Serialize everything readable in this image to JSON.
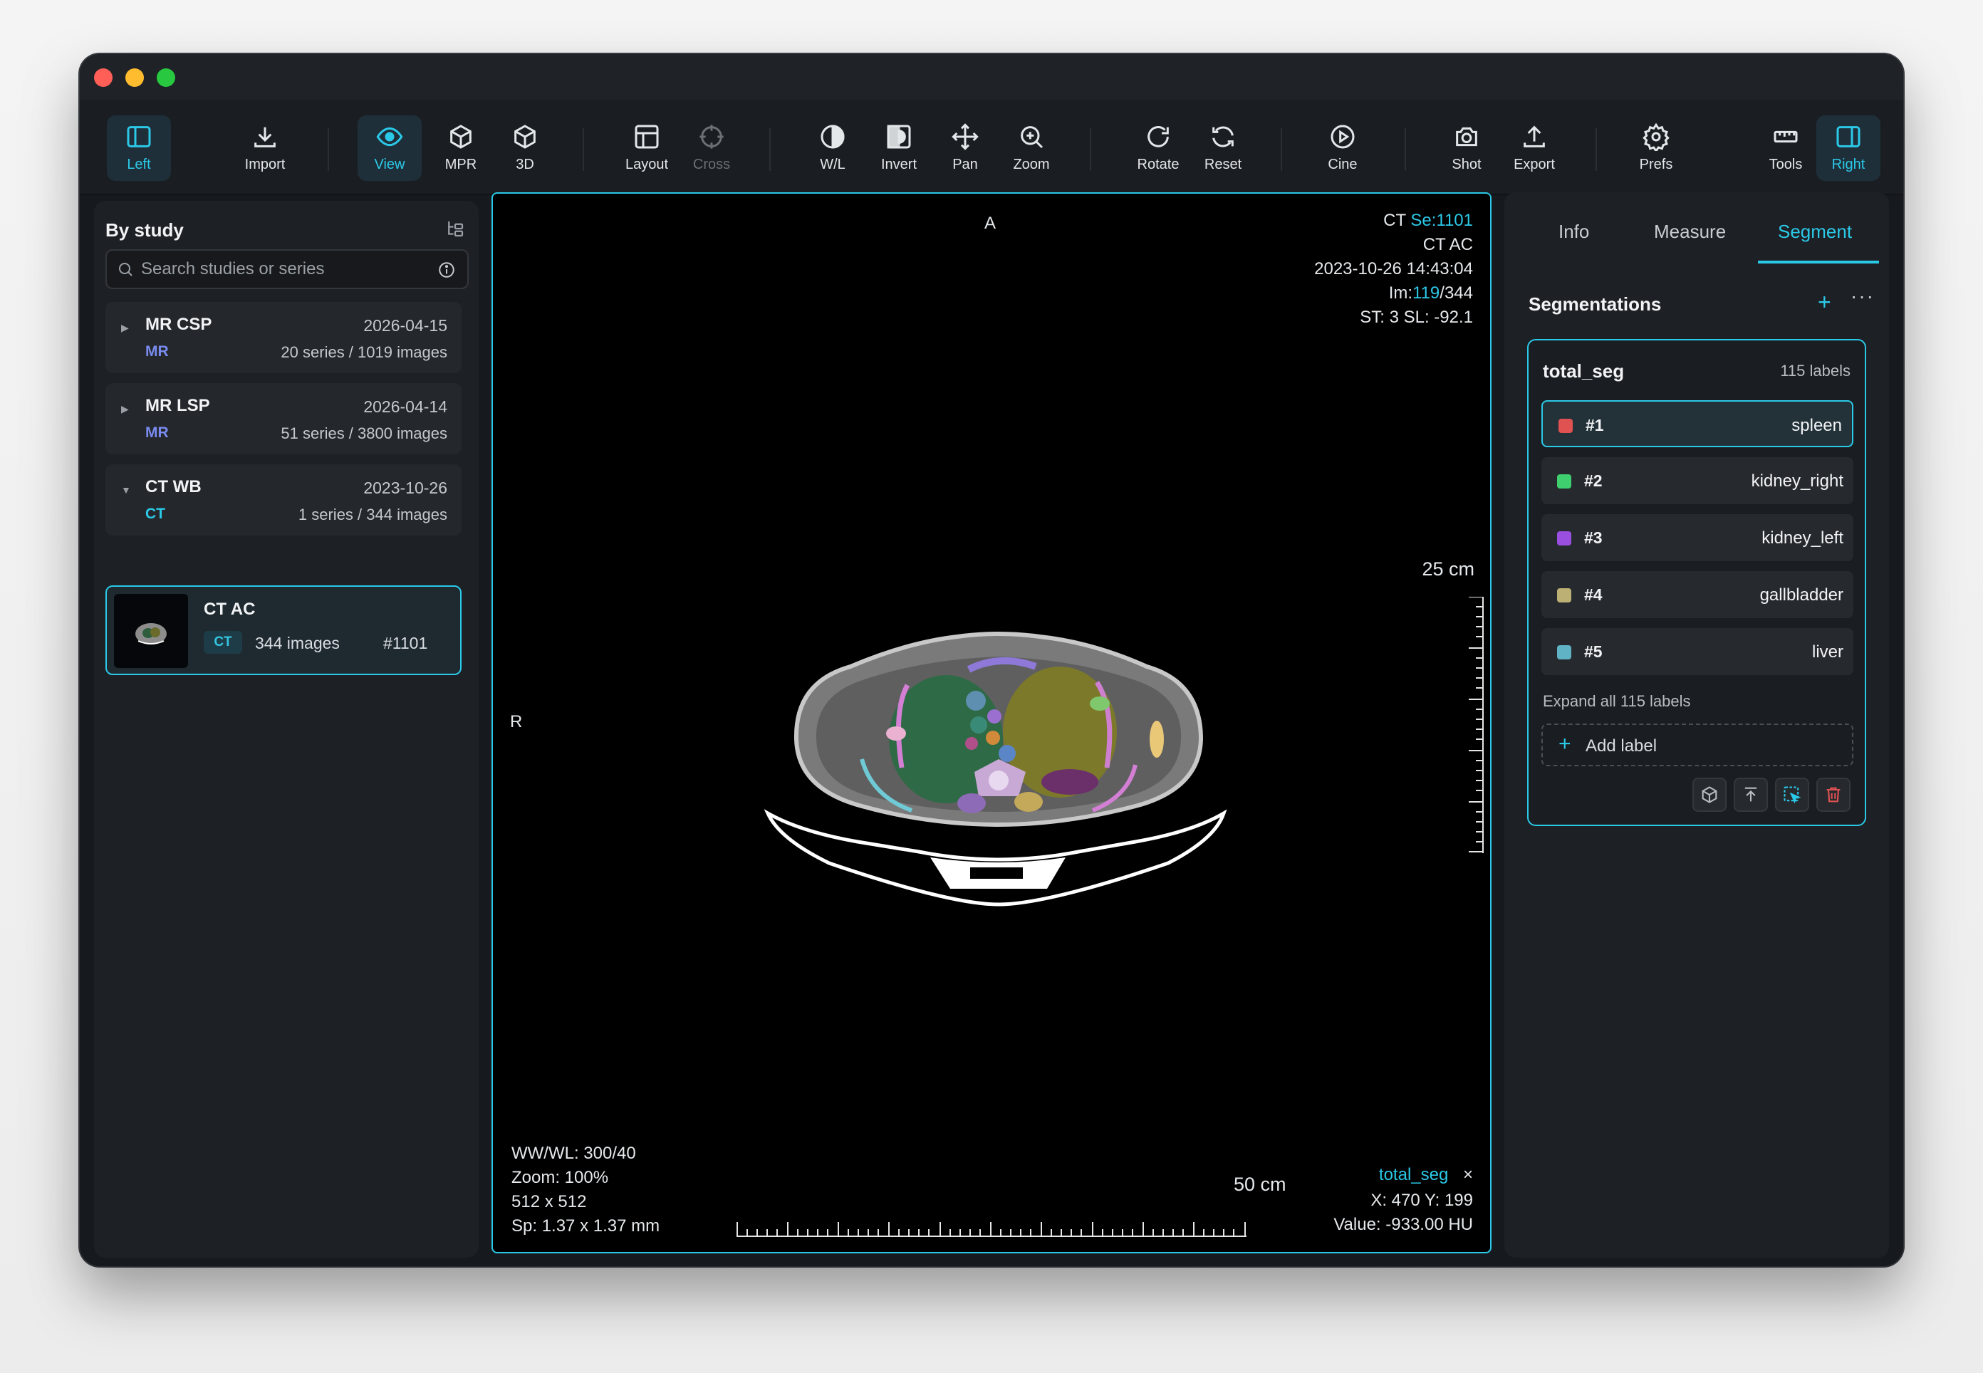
{
  "toolbar": {
    "left": "Left",
    "import": "Import",
    "view": "View",
    "mpr": "MPR",
    "three_d": "3D",
    "layout": "Layout",
    "cross": "Cross",
    "wl": "W/L",
    "invert": "Invert",
    "pan": "Pan",
    "zoom": "Zoom",
    "rotate": "Rotate",
    "reset": "Reset",
    "cine": "Cine",
    "shot": "Shot",
    "export": "Export",
    "prefs": "Prefs",
    "tools": "Tools",
    "right": "Right"
  },
  "left_panel": {
    "title": "By study",
    "search_placeholder": "Search studies or series",
    "studies": [
      {
        "name": "MR CSP",
        "date": "2026-04-15",
        "modality": "MR",
        "count": "20 series / 1019 images",
        "expanded": false
      },
      {
        "name": "MR LSP",
        "date": "2026-04-14",
        "modality": "MR",
        "count": "51 series / 3800 images",
        "expanded": false
      },
      {
        "name": "CT WB",
        "date": "2023-10-26",
        "modality": "CT",
        "count": "1 series / 344 images",
        "expanded": true
      }
    ],
    "series": {
      "name": "CT AC",
      "modality": "CT",
      "images": "344 images",
      "number": "#1101"
    }
  },
  "viewport": {
    "orient_top": "A",
    "orient_left": "R",
    "top_right": {
      "modality": "CT",
      "series_label": "Se:",
      "series_num": "1101",
      "desc": "CT AC",
      "datetime": "2023-10-26 14:43:04",
      "im_label": "Im:",
      "im_cur": "119",
      "im_total": "/344",
      "slice": "ST: 3  SL: -92.1"
    },
    "scale_v": "25 cm",
    "scale_h": "50 cm",
    "bottom_left": {
      "wwwl": "WW/WL: 300/40",
      "zoom": "Zoom: 100%",
      "matrix": "512 x 512",
      "spacing": "Sp: 1.37 x 1.37 mm"
    },
    "bottom_right": {
      "seg": "total_seg",
      "close": "×",
      "coords": "X: 470  Y: 199",
      "value": "Value: -933.00 HU"
    }
  },
  "right_panel": {
    "tabs": [
      "Info",
      "Measure",
      "Segment"
    ],
    "active_tab": "Segment",
    "section_title": "Segmentations",
    "add": "+",
    "more": "···",
    "segmentation": {
      "name": "total_seg",
      "count": "115 labels",
      "labels": [
        {
          "num": "#1",
          "name": "spleen",
          "color": "#e05252"
        },
        {
          "num": "#2",
          "name": "kidney_right",
          "color": "#3fcf6e"
        },
        {
          "num": "#3",
          "name": "kidney_left",
          "color": "#9b4fe0"
        },
        {
          "num": "#4",
          "name": "gallbladder",
          "color": "#bdb075"
        },
        {
          "num": "#5",
          "name": "liver",
          "color": "#5fb3c4"
        }
      ],
      "expand": "Expand all 115 labels",
      "add_label": "Add label",
      "add_plus": "+"
    }
  },
  "colors": {
    "accent": "#2bc9e8",
    "mr": "#7a8cf0",
    "ct": "#2bc9e8"
  }
}
